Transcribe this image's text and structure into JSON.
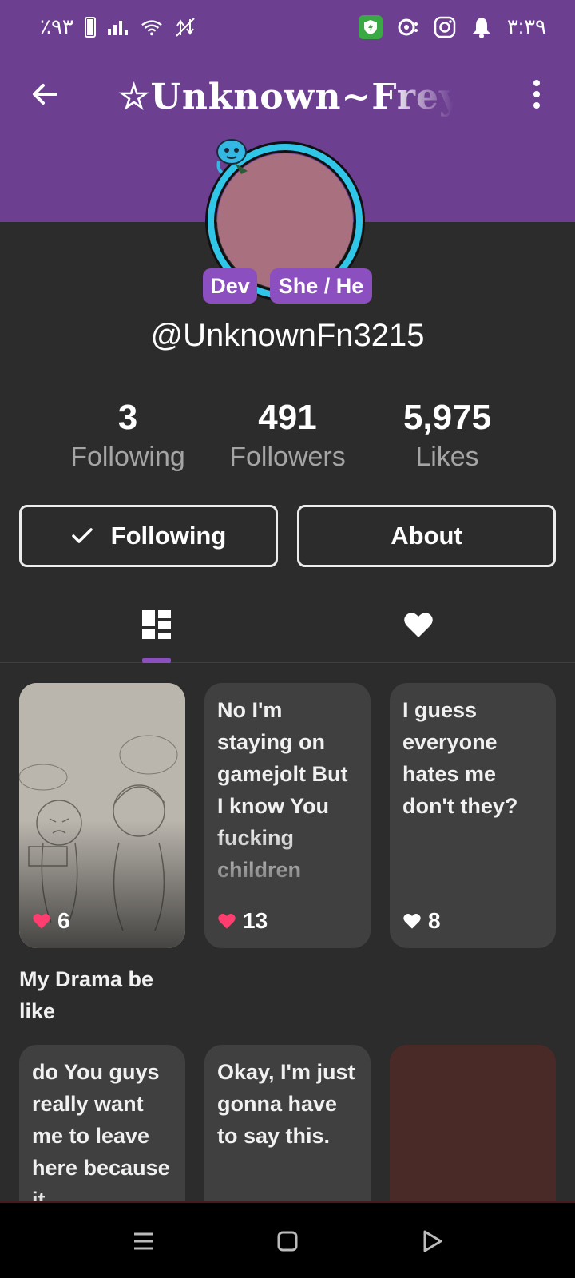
{
  "status_bar": {
    "battery_text": "٪۹۳",
    "time": "۳:۳۹"
  },
  "header": {
    "title": "☆Unknown~Freya"
  },
  "profile": {
    "badge_role": "Dev",
    "badge_pronouns": "She / He",
    "handle": "@UnknownFn3215",
    "avatar_ring_color": "#2fc6e8",
    "accent_color": "#8b4fbf",
    "header_color": "#6d3f91"
  },
  "stats": [
    {
      "value": "3",
      "label": "Following"
    },
    {
      "value": "491",
      "label": "Followers"
    },
    {
      "value": "5,975",
      "label": "Likes"
    }
  ],
  "actions": {
    "following_label": "Following",
    "about_label": "About"
  },
  "tabs": [
    "posts-grid-icon",
    "heart-icon"
  ],
  "posts": [
    {
      "type": "image",
      "likes": "6",
      "caption": "My Drama be like",
      "liked": true
    },
    {
      "type": "text",
      "text": "No I'm staying on gamejolt But I know You fucking children",
      "likes": "13",
      "liked": true
    },
    {
      "type": "text",
      "text": "I guess everyone hates me don't they?",
      "likes": "8",
      "liked": false
    },
    {
      "type": "text",
      "text": "do You guys really want me to leave here because it"
    },
    {
      "type": "text",
      "text": "Okay, I'm just gonna have to say this."
    },
    {
      "type": "image"
    }
  ],
  "nav": [
    "menu-icon",
    "home-icon",
    "back-icon"
  ]
}
